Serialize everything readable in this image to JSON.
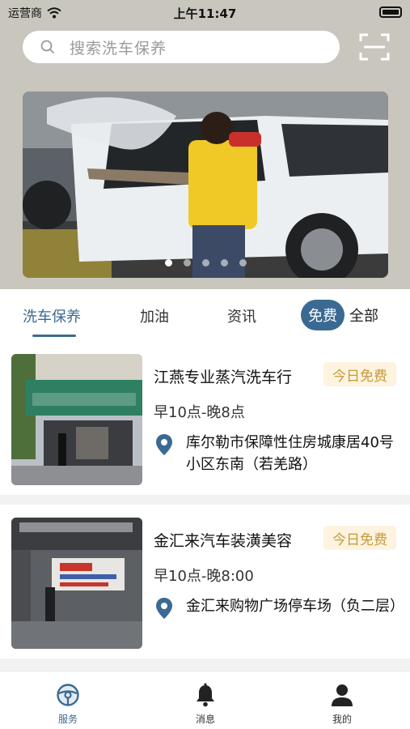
{
  "status": {
    "carrier": "运营商",
    "time": "上午11:47"
  },
  "search": {
    "placeholder": "搜索洗车保养",
    "scan_icon": "scan-icon"
  },
  "banner": {
    "page_count": 5,
    "active_page": 1
  },
  "tabs": [
    {
      "label": "洗车保养",
      "active": true
    },
    {
      "label": "加油",
      "active": false
    },
    {
      "label": "资讯",
      "active": false
    }
  ],
  "filter": {
    "free_label": "免费",
    "all_label": "全部",
    "selected": "免费"
  },
  "shops": [
    {
      "name": "江燕专业蒸汽洗车行",
      "badge": "今日免费",
      "hours": "早10点-晚8点",
      "address": "库尔勒市保障性住房城康居40号小区东南（若羌路）"
    },
    {
      "name": "金汇来汽车装潢美容",
      "badge": "今日免费",
      "hours": "早10点-晚8:00",
      "address": "金汇来购物广场停车场（负二层）"
    }
  ],
  "bottom_nav": [
    {
      "label": "服务",
      "icon": "steering-wheel-icon",
      "active": true
    },
    {
      "label": "消息",
      "icon": "bell-icon",
      "active": false
    },
    {
      "label": "我的",
      "icon": "user-icon",
      "active": false
    }
  ],
  "colors": {
    "accent": "#3a6a92",
    "badge_text": "#c49a3a",
    "badge_bg": "#fdf3df",
    "header_bg": "#c8c6bd"
  }
}
